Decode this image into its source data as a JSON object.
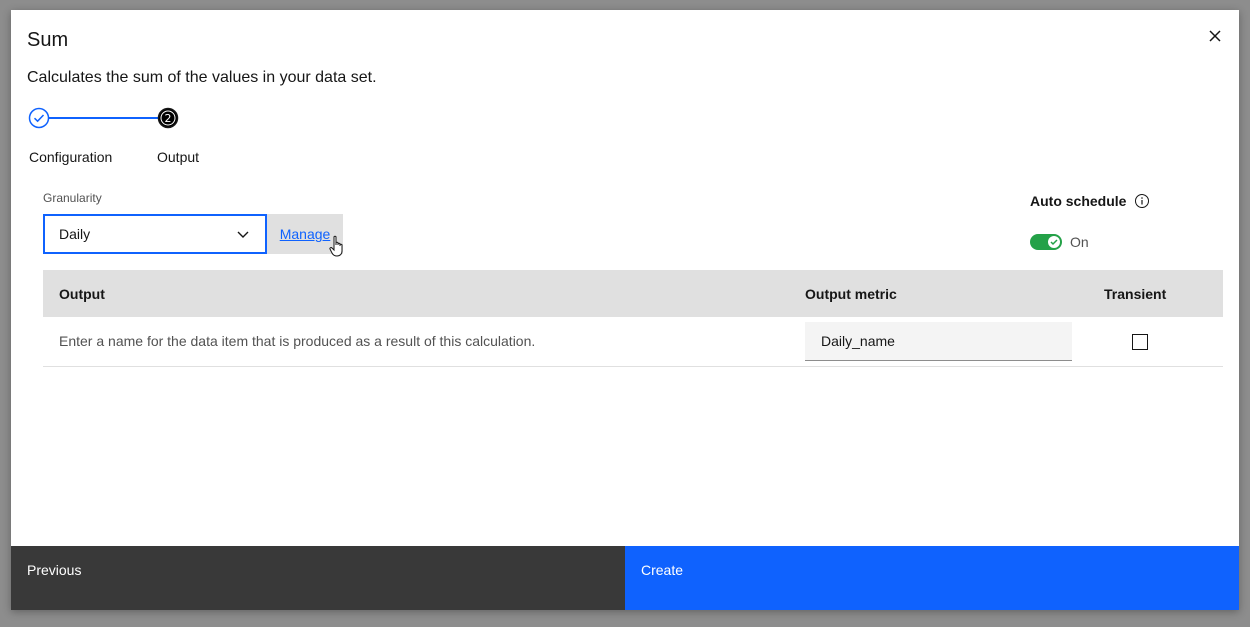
{
  "modal": {
    "title": "Sum",
    "description": "Calculates the sum of the values in your data set."
  },
  "progress": {
    "steps": [
      {
        "label": "Configuration",
        "state": "complete"
      },
      {
        "label": "Output",
        "state": "current",
        "number": "2"
      }
    ]
  },
  "granularity": {
    "label": "Granularity",
    "selected": "Daily",
    "manage_label": "Manage"
  },
  "auto_schedule": {
    "label": "Auto schedule",
    "state_label": "On",
    "enabled": true
  },
  "table": {
    "headers": [
      "Output",
      "Output metric",
      "Transient"
    ],
    "rows": [
      {
        "description": "Enter a name for the data item that is produced as a result of this calculation.",
        "metric_value": "Daily_name",
        "transient": false
      }
    ]
  },
  "footer": {
    "previous_label": "Previous",
    "create_label": "Create"
  },
  "colors": {
    "primary": "#0f62fe",
    "toggle_on": "#24a148",
    "secondary_button": "#393939"
  }
}
